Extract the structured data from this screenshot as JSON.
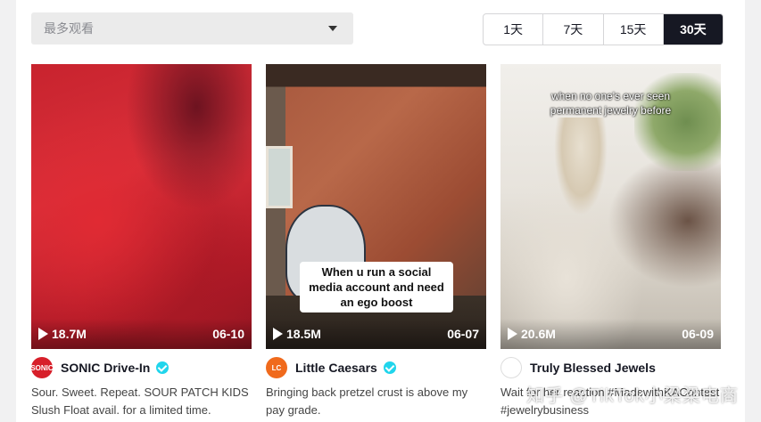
{
  "filters": {
    "sort_placeholder": "最多观看",
    "ranges": [
      "1天",
      "7天",
      "15天",
      "30天"
    ],
    "active_range": "30天"
  },
  "videos": [
    {
      "views": "18.7M",
      "date": "06-10",
      "author": "SONIC Drive-In",
      "avatar_text": "SONIC",
      "verified": true,
      "description": "Sour. Sweet. Repeat. SOUR PATCH KIDS Slush Float avail. for a limited time."
    },
    {
      "views": "18.5M",
      "date": "06-07",
      "author": "Little Caesars",
      "avatar_text": "LC",
      "verified": true,
      "overlay_caption": "When u run a social media account and need an ego boost",
      "description": "Bringing back pretzel crust is above my pay grade."
    },
    {
      "views": "20.6M",
      "date": "06-09",
      "author": "Truly Blessed Jewels",
      "avatar_text": "",
      "verified": false,
      "overlay_caption": "when no one's ever seen permanent jewelry before",
      "description": "Wait for her reaction #MadewithKAContest #jewelrybusiness"
    }
  ],
  "watermark": "知乎 @TikTok小梁梁电商"
}
